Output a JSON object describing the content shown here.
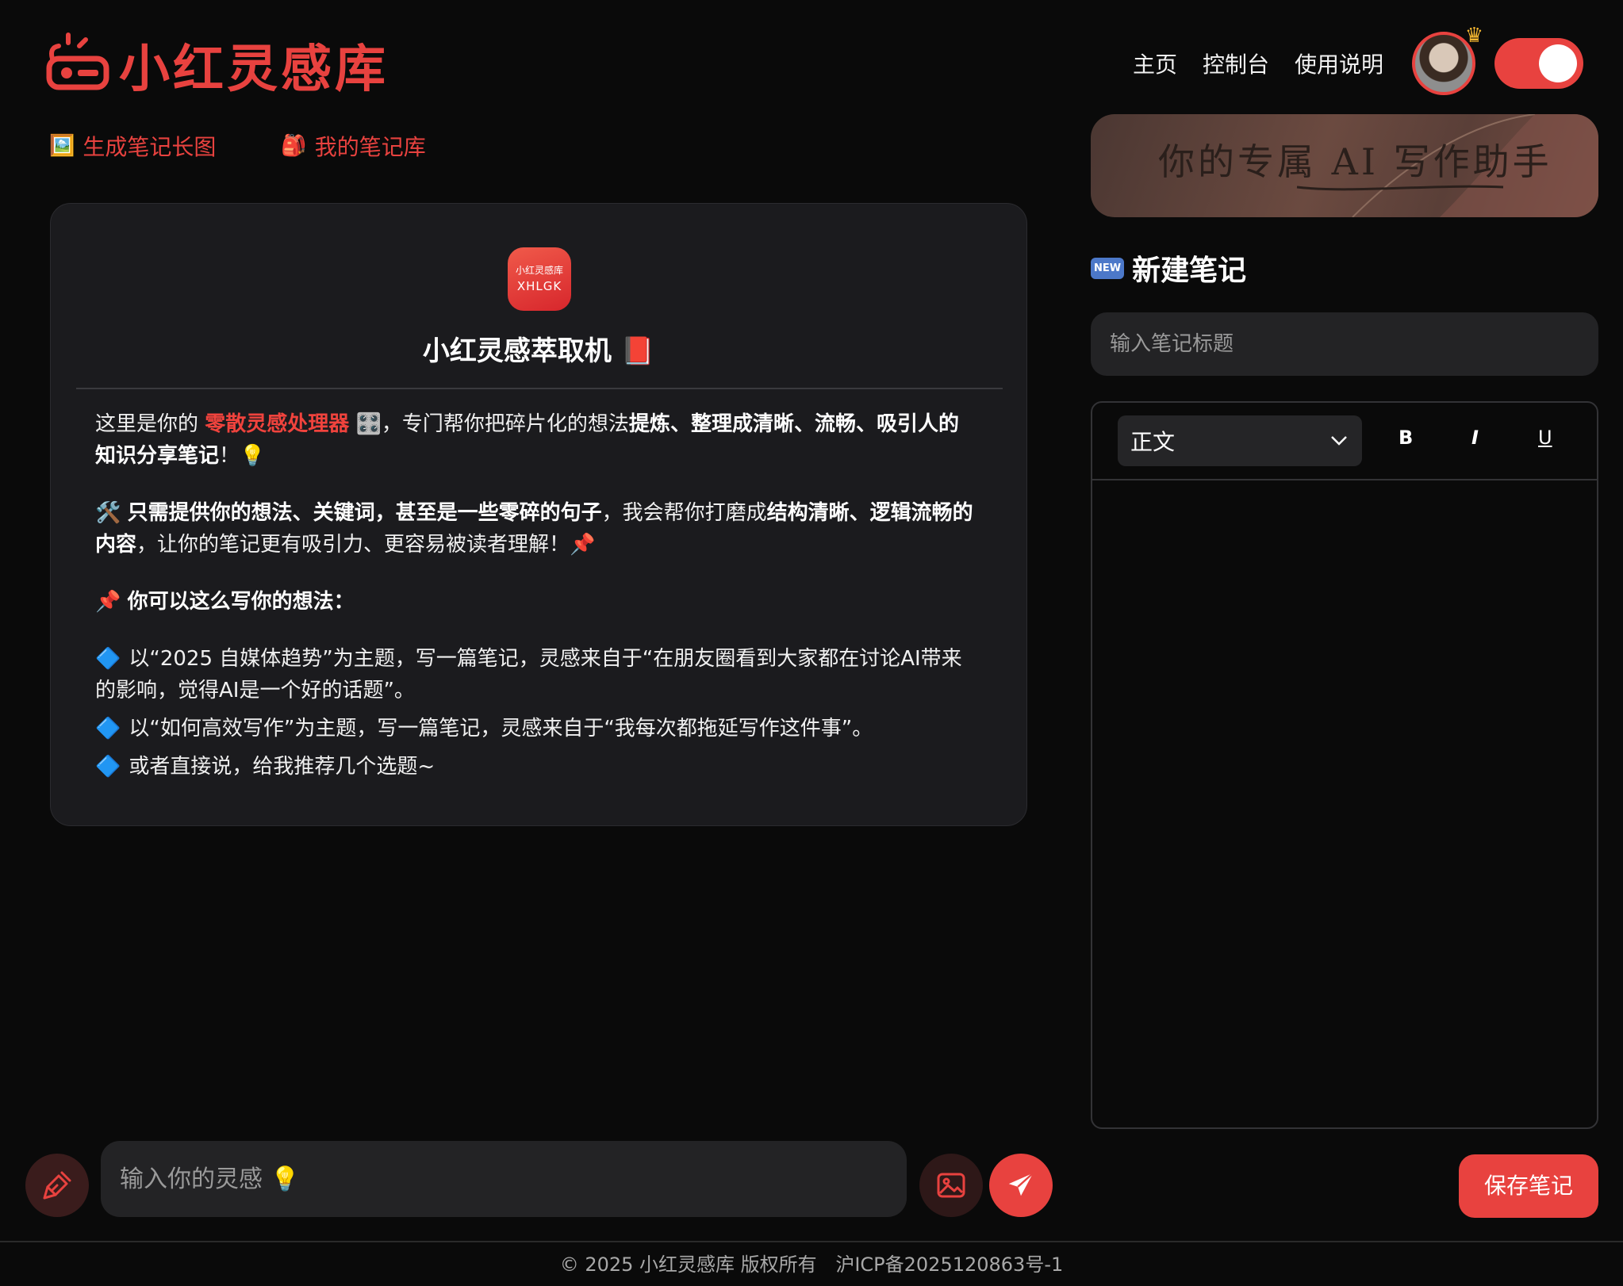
{
  "header": {
    "logo_text": "小红灵感库",
    "nav": [
      "主页",
      "控制台",
      "使用说明"
    ],
    "crown_icon": "crown-icon",
    "accent_color": "#e8423f"
  },
  "subtabs": [
    {
      "icon": "🖼️",
      "label": "生成笔记长图"
    },
    {
      "icon": "🎒",
      "label": "我的笔记库"
    }
  ],
  "intro": {
    "app_icon_line1": "小红灵感库",
    "app_icon_line2": "XHLGK",
    "title": "小红灵感萃取机 📕",
    "p1_a": "这里是你的 ",
    "p1_hl": "零散灵感处理器",
    "p1_b": " 🎛️，专门帮你把碎片化的想法",
    "p1_bold1": "提炼",
    "p1_sep": "、",
    "p1_bold2": "整理成清晰、流畅、吸引人的知识分享笔记",
    "p1_c": "！💡",
    "p2_icon": "🛠️",
    "p2_bold1": "只需提供你的想法、关键词，甚至是一些零碎的句子",
    "p2_a": "，我会帮你打磨成",
    "p2_bold2": "结构清晰、逻辑流畅的内容",
    "p2_b": "，让你的笔记更有吸引力、更容易被读者理解！📌",
    "p3_icon": "📌",
    "p3_bold": "你可以这么写你的想法：",
    "bullet_icon": "🔷",
    "bullets": [
      "以“2025 自媒体趋势”为主题，写一篇笔记，灵感来自于“在朋友圈看到大家都在讨论AI带来的影响，觉得AI是一个好的话题”。",
      "以“如何高效写作”为主题，写一篇笔记，灵感来自于“我每次都拖延写作这件事”。",
      "或者直接说，给我推荐几个选题~"
    ]
  },
  "right_panel": {
    "banner_text": "你的专属 AI 写作助手",
    "new_badge": "NEW",
    "new_title": "新建笔记",
    "title_placeholder": "输入笔记标题",
    "format_value": "正文",
    "bold_label": "B",
    "italic_label": "I",
    "underline_label": "U",
    "save_label": "保存笔记"
  },
  "chat": {
    "placeholder": "输入你的灵感 💡"
  },
  "footer": {
    "copyright": "© 2025 小红灵感库 版权所有",
    "icp": "沪ICP备2025120863号-1"
  }
}
